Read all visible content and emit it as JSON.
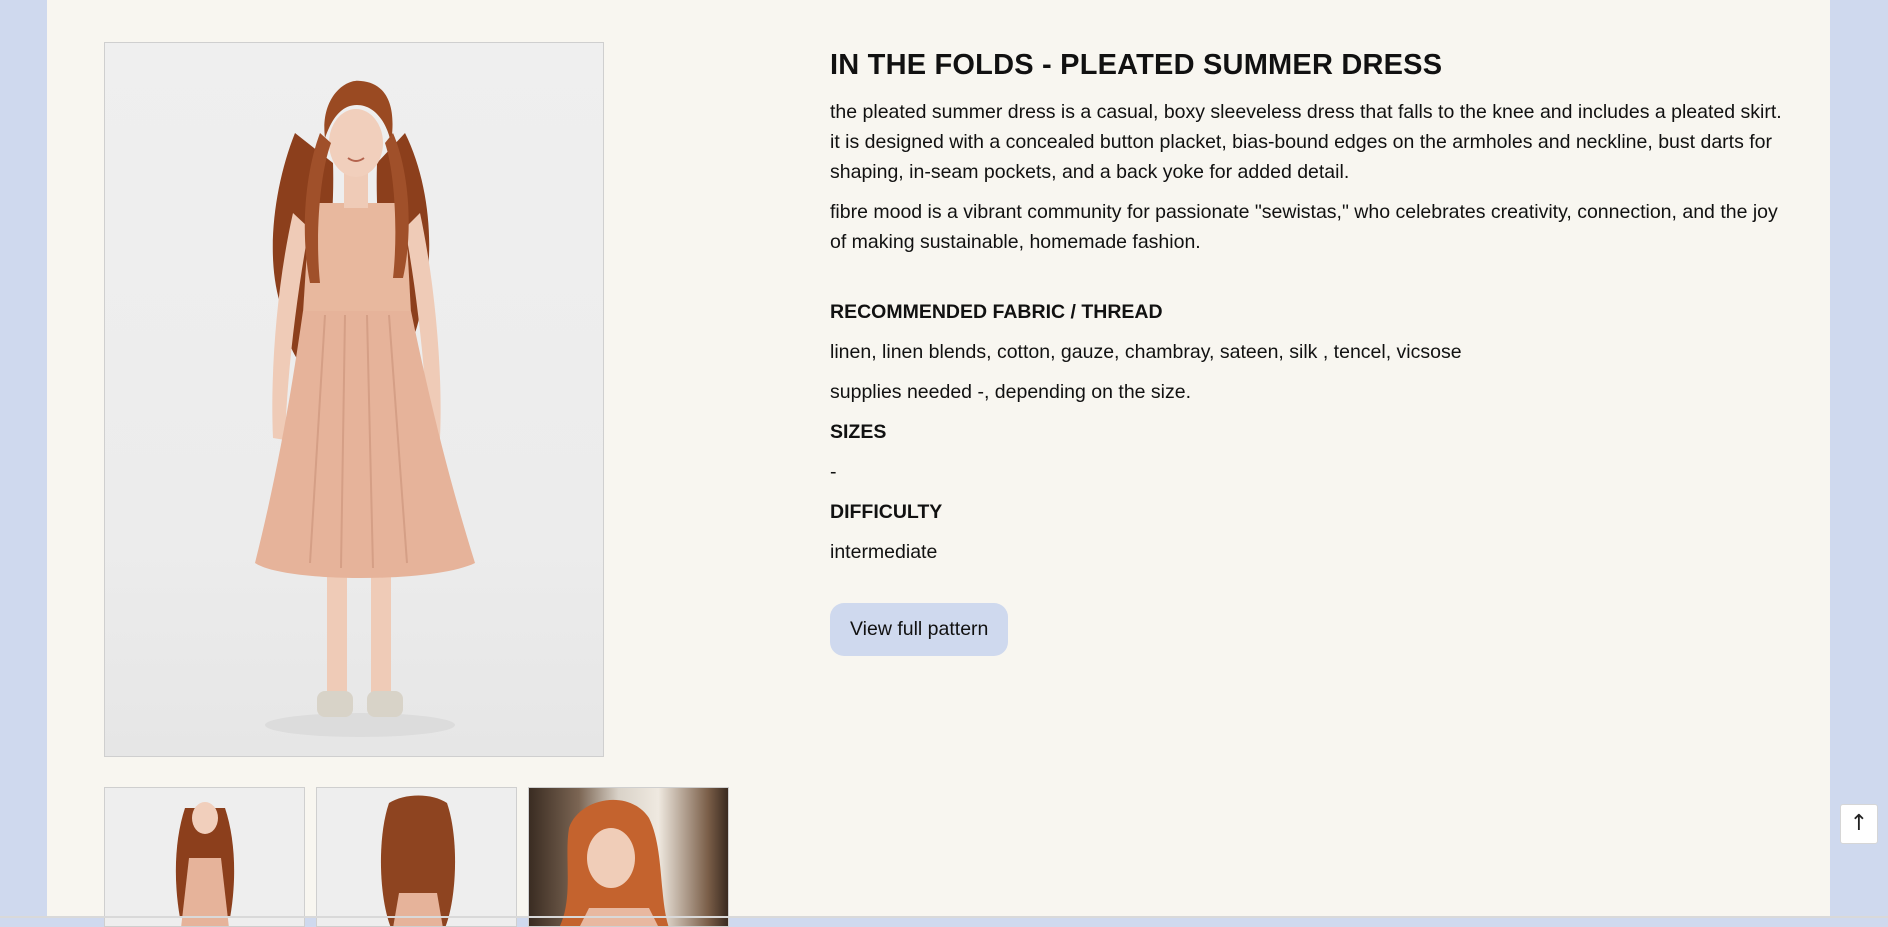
{
  "product": {
    "title": "IN THE FOLDS - PLEATED SUMMER DRESS",
    "description": "the pleated summer dress is a casual, boxy sleeveless dress that falls to the knee and includes a pleated skirt. it is designed with a concealed button placket, bias-bound edges on the armholes and neckline, bust darts for shaping, in-seam pockets, and a back yoke for added detail.",
    "about": "fibre mood is a vibrant community for passionate \"sewistas,\" who celebrates creativity, connection, and the joy of making sustainable, homemade fashion.",
    "fabric_heading": "RECOMMENDED FABRIC / THREAD",
    "fabric_list": "linen, linen blends, cotton, gauze, chambray, sateen, silk , tencel, vicsose",
    "supplies": "supplies needed -, depending on the size.",
    "sizes_heading": "SIZES",
    "sizes_value": "-",
    "difficulty_heading": "DIFFICULTY",
    "difficulty_value": "intermediate",
    "button_label": "View full pattern"
  },
  "gallery": {
    "main_image": "model-front-photo",
    "thumbnails": [
      "thumb-front",
      "thumb-back",
      "thumb-closeup"
    ]
  },
  "scroll_top": {
    "icon": "arrow-up-icon",
    "glyph": "↑"
  },
  "colors": {
    "page_background": "#f8f6f0",
    "outer_background": "#cfd9ee",
    "button_background": "#cfd9ee",
    "dress": "#e8b8a0",
    "hair": "#9a4a22"
  }
}
